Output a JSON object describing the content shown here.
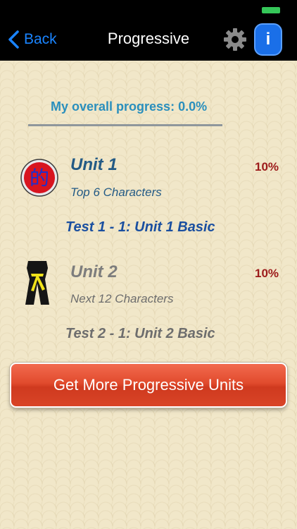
{
  "nav": {
    "back_label": "Back",
    "title": "Progressive",
    "info_label": "i"
  },
  "overall": {
    "text": "My overall progress: 0.0%"
  },
  "units": [
    {
      "title": "Unit  1",
      "subtitle": "Top 6 Characters",
      "percent": "10%",
      "test_label": "Test  1 - 1: Unit 1 Basic",
      "icon": "character-seal-icon",
      "icon_glyph": "的"
    },
    {
      "title": "Unit  2",
      "subtitle": "Next 12 Characters",
      "percent": "10%",
      "test_label": "Test  2 - 1: Unit 2 Basic",
      "icon": "yellow-belt-icon"
    }
  ],
  "actions": {
    "more_units_label": "Get More Progressive Units"
  },
  "colors": {
    "accent_blue": "#1a84ff",
    "button_red": "#e14b2d",
    "percent_red": "#9c1a1a",
    "background": "#f1e7c9"
  }
}
